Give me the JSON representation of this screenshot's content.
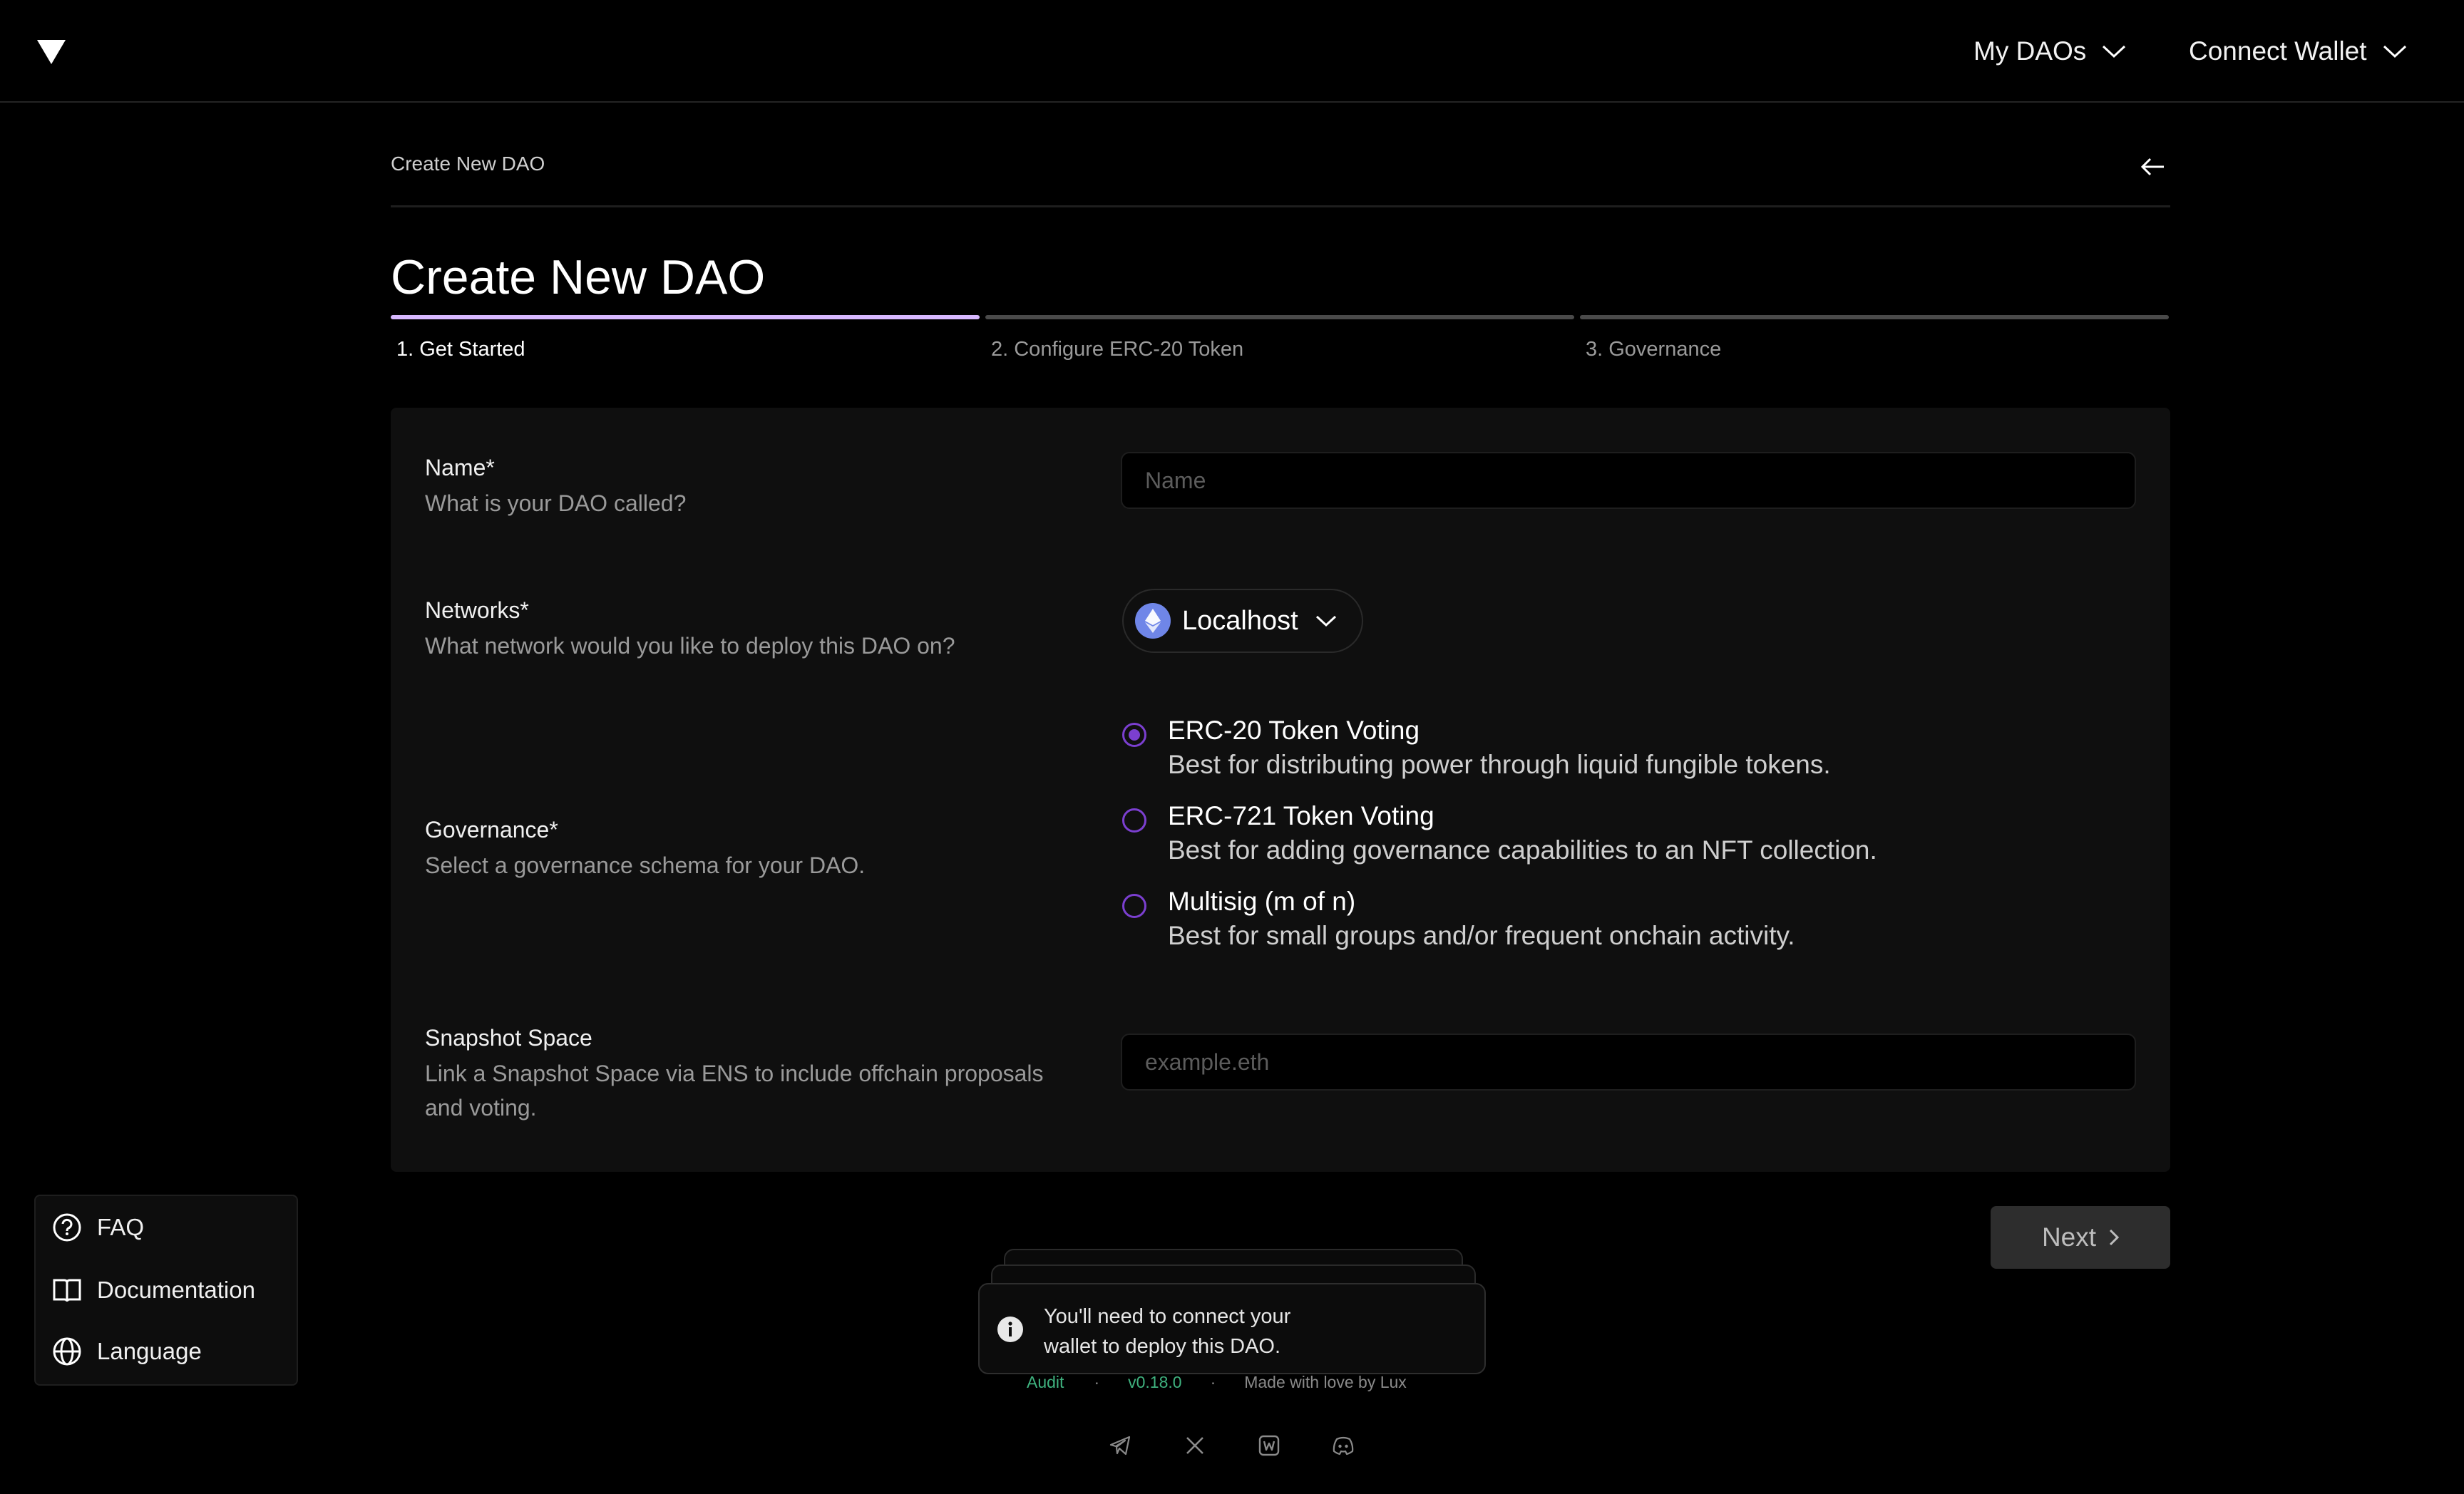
{
  "header": {
    "logo_icon": "triangle-logo",
    "my_daos_label": "My DAOs",
    "connect_wallet_label": "Connect Wallet"
  },
  "breadcrumb": {
    "label": "Create New DAO"
  },
  "page": {
    "title": "Create New DAO"
  },
  "steps": [
    {
      "label": "1. Get Started",
      "active": true
    },
    {
      "label": "2. Configure ERC-20 Token",
      "active": false
    },
    {
      "label": "3. Governance",
      "active": false
    }
  ],
  "form": {
    "name": {
      "label": "Name*",
      "description": "What is your DAO called?",
      "placeholder": "Name",
      "value": ""
    },
    "networks": {
      "label": "Networks*",
      "description": "What network would you like to deploy this DAO on?",
      "selected": "Localhost",
      "icon": "ethereum-icon"
    },
    "governance": {
      "label": "Governance*",
      "description": "Select a governance schema for your DAO.",
      "options": [
        {
          "title": "ERC-20 Token Voting",
          "description": "Best for distributing power through liquid fungible tokens.",
          "checked": true
        },
        {
          "title": "ERC-721 Token Voting",
          "description": "Best for adding governance capabilities to an NFT collection.",
          "checked": false
        },
        {
          "title": "Multisig (m of n)",
          "description": "Best for small groups and/or frequent onchain activity.",
          "checked": false
        }
      ]
    },
    "snapshot": {
      "label": "Snapshot Space",
      "description_line1": "Link a Snapshot Space via ENS to include offchain proposals",
      "description_line2": "and voting.",
      "placeholder": "example.eth",
      "value": ""
    }
  },
  "next_label": "Next",
  "side_menu": [
    {
      "label": "FAQ",
      "icon": "help-circle-icon"
    },
    {
      "label": "Documentation",
      "icon": "book-icon"
    },
    {
      "label": "Language",
      "icon": "globe-icon"
    }
  ],
  "toast": {
    "line1": "You'll need to connect your",
    "line2": "wallet to deploy this DAO.",
    "icon": "info-icon"
  },
  "footer": {
    "audit": "Audit",
    "version": "v0.18.0",
    "made_with": "Made with love by Lux",
    "separator": "·",
    "social_icons": [
      "telegram-icon",
      "x-icon",
      "warpcast-icon",
      "discord-icon"
    ]
  },
  "colors": {
    "accent": "#7b3fd0",
    "step_active": "#d7b8ff",
    "footer_link": "#3fb27f"
  }
}
